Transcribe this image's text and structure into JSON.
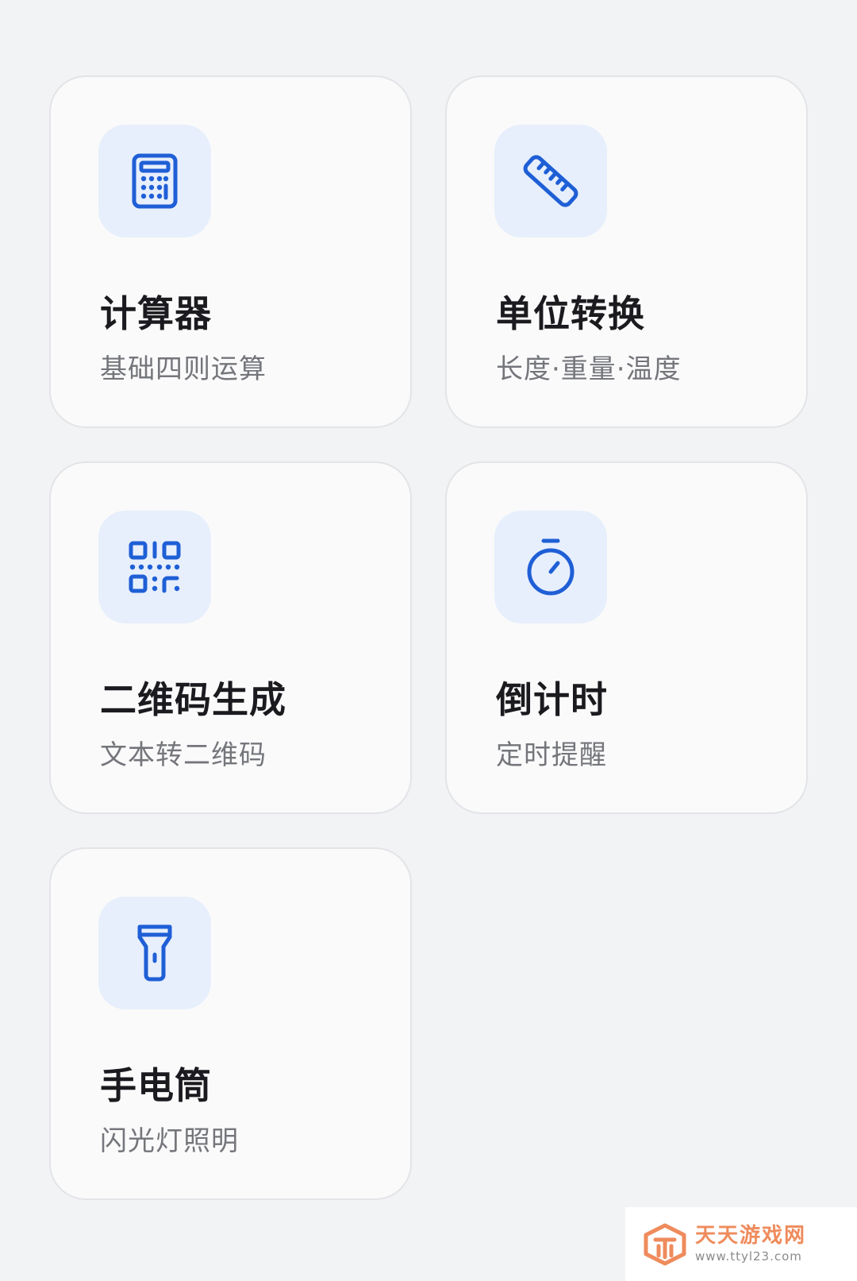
{
  "accent_color": "#1f5fd6",
  "tools": [
    {
      "icon": "calculator-icon",
      "title": "计算器",
      "desc": "基础四则运算"
    },
    {
      "icon": "ruler-icon",
      "title": "单位转换",
      "desc": "长度·重量·温度"
    },
    {
      "icon": "qr-code-icon",
      "title": "二维码生成",
      "desc": "文本转二维码"
    },
    {
      "icon": "stopwatch-icon",
      "title": "倒计时",
      "desc": "定时提醒"
    },
    {
      "icon": "flashlight-icon",
      "title": "手电筒",
      "desc": "闪光灯照明"
    }
  ],
  "watermark": {
    "name": "天天游戏网",
    "url": "www.ttyl23.com"
  }
}
